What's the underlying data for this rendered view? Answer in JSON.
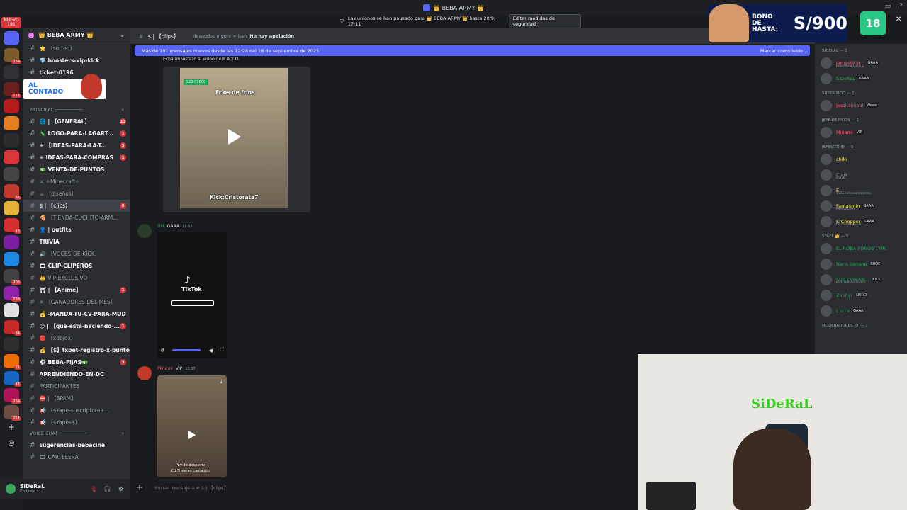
{
  "window": {
    "title": "👑 BEBA ARMY 👑"
  },
  "security": {
    "notice": "Las uniones se han pausado para 👑 BEBA ARMY 👑 hasta 20/9, 17:11",
    "button": "Editar medidas de seguridad"
  },
  "rail": {
    "nuevo_label": "NUEVO",
    "nuevo_count": "191",
    "badges": [
      "164",
      "117",
      "97",
      "43",
      "206",
      "738",
      "84",
      "21",
      "47",
      "164",
      "211"
    ]
  },
  "guild": {
    "name": "👑 BEBA ARMY 👑"
  },
  "channels": [
    {
      "name": "⭐ 〔sorteo〕",
      "type": "hash",
      "style": "dim"
    },
    {
      "name": "💎 boosters-vip-kick",
      "type": "hash",
      "style": "bright"
    },
    {
      "name": "ticket-0196",
      "type": "hash",
      "style": "bright"
    }
  ],
  "promo": {
    "line1": "AL",
    "line2": "CONTADO"
  },
  "category_principal": "PRINCIPAL ──────────",
  "channels2": [
    {
      "name": "🌐 | 【GENERAL】",
      "style": "bright",
      "badge": "13"
    },
    {
      "name": "🦎 LOGO-PARA-LAGART...",
      "style": "bright",
      "badge": "1"
    },
    {
      "name": "✳ 【IDEAS-PARA-LA-T...",
      "style": "bright",
      "badge": "3"
    },
    {
      "name": "✳ IDEAS-PARA-COMPRAS",
      "style": "bright",
      "badge": "1"
    },
    {
      "name": "💵 VENTA-DE-PUNTOS",
      "style": "bright",
      "badge": ""
    },
    {
      "name": "⚔ ✧Minecraft✧",
      "style": "dim",
      "badge": ""
    },
    {
      "name": "☕ 〔diseños〕",
      "style": "dim",
      "badge": ""
    },
    {
      "name": "$ | 【clips】",
      "style": "active",
      "badge": "8"
    },
    {
      "name": "🍕 〔TIENDA-CUCHITO-ARM...",
      "style": "dim",
      "badge": ""
    },
    {
      "name": "👤 | outfits",
      "style": "bright",
      "badge": ""
    },
    {
      "name": "TRIVIA",
      "style": "bright",
      "badge": ""
    },
    {
      "name": "🔊 〔VOCES-DE-KICK〕",
      "style": "dim",
      "badge": ""
    },
    {
      "name": "🎞 CLIP-CLIPEROS",
      "style": "bright",
      "badge": ""
    },
    {
      "name": "👑 VIP-EXCLUSIVO",
      "style": "dim",
      "badge": ""
    },
    {
      "name": "⛩ | 【Anime】",
      "style": "bright",
      "badge": "1"
    },
    {
      "name": "✳ 〔GANADORES-DEL-MES〕",
      "style": "dim",
      "badge": ""
    },
    {
      "name": "💰 -MANDA-TU-CV-PARA-MOD",
      "style": "bright",
      "badge": ""
    },
    {
      "name": "😊 | 【que-está-haciendo-...",
      "style": "bright",
      "badge": "1"
    },
    {
      "name": "🔴 〔xdbjdx〕",
      "style": "dim",
      "badge": ""
    },
    {
      "name": "💰 【$】txbet-registro-x-puntos...",
      "style": "bright",
      "badge": ""
    },
    {
      "name": "⚽ BEBA-FIJAS💵",
      "style": "bright",
      "badge": "3"
    },
    {
      "name": "APRENDIENDO-EN-DC",
      "style": "bright",
      "badge": ""
    },
    {
      "name": "PARTICIPANTES",
      "style": "dim",
      "badge": ""
    },
    {
      "name": "⛔ | 【SPAM】",
      "style": "dim",
      "badge": ""
    },
    {
      "name": "📢 〔$Yape-suscriptorea...",
      "style": "dim",
      "badge": ""
    },
    {
      "name": "📢 〔$Yapes$〕",
      "style": "dim",
      "badge": ""
    }
  ],
  "category_voice": "VOICE CHAT ──────────",
  "channels3": [
    {
      "name": "sugerencias-bebacine",
      "style": "bright"
    },
    {
      "name": "🎞 CARTELERA",
      "style": "dim"
    }
  ],
  "user": {
    "name": "SiDeRaL",
    "status": "En línea"
  },
  "header": {
    "channel": "$ | 【clips】",
    "topic_prefix": "desnudos o gore = ban.",
    "topic_bold": "No hay apelación"
  },
  "newbar": {
    "text": "Más de 101 mensajes nuevos desde las 12:28 del 18 de septiembre de 2025",
    "mark": "Marcar como leído"
  },
  "messages": {
    "caption": "Echa un vistazo al video de R A Y O.",
    "video1_title": "Fríos de fríos",
    "video1_score": "523 / 1000",
    "video1_credit": "Kick:Cristorata7",
    "msg2_author": "DM",
    "msg2_tag": "GAAA",
    "msg2_time": "11:37",
    "tiktok_label": "TikTok",
    "msg3_author": "Minami",
    "msg3_tag": "VIP",
    "msg3_time": "11:37",
    "video3_caption1": "Pov: te despierta",
    "video3_caption2": "Ed Sheeran cantando"
  },
  "composer": {
    "placeholder": "Enviar mensaje a # $ | 【clips】"
  },
  "members": {
    "sideral_cat": "SIDERAL — 2",
    "super_cat": "SUPER MOD — 1",
    "jefe_cat": "JEFE DE MODS — 1",
    "jefesito_cat": "JEFESITO 😎 — 5",
    "staff_cat": "STAFF 👑 — 5",
    "mods_cat": "MODERADORES 🛡 — 1",
    "list": [
      {
        "section": "sideral",
        "name": "JamesOCa...",
        "tag": "GAAA",
        "sub": "Jugando a Dota 2",
        "color": "#ff4d6d"
      },
      {
        "section": "sideral",
        "name": "SiDeRaL",
        "tag": "GAAA",
        "sub": "",
        "color": "#3ba55c"
      },
      {
        "section": "super",
        "name": "Jessi-senpai",
        "tag": "Weee",
        "sub": "",
        "color": "#ff4d6d"
      },
      {
        "section": "jefe",
        "name": "Minami",
        "tag": "VIP",
        "sub": "",
        "color": "#ff4d6d"
      },
      {
        "section": "jefesito",
        "name": "chiki",
        "tag": "",
        "sub": "",
        "color": "#f2e05a"
      },
      {
        "section": "jefesito",
        "name": "Clark.",
        "tag": "",
        "sub": "RSQK",
        "color": "#949ba4"
      },
      {
        "section": "jefesito",
        "name": "E...",
        "tag": "",
        "sub": "www.kick.com/elimao",
        "color": "#f2e05a"
      },
      {
        "section": "jefesito",
        "name": "Fantasmin",
        "tag": "GAAA",
        "sub": "Pienso bien.",
        "color": "#f2e05a"
      },
      {
        "section": "jefesito",
        "name": "SrChopper",
        "tag": "GAAA",
        "sub": "En canal de voz",
        "color": "#f2e05a"
      },
      {
        "section": "staff",
        "name": "EL ROBA FONOS TYRON...",
        "tag": "",
        "sub": "",
        "color": "#23a55a"
      },
      {
        "section": "staff",
        "name": "Nana banana",
        "tag": "RBOE",
        "sub": "",
        "color": "#23a55a"
      },
      {
        "section": "staff",
        "name": "SUB COMAN...",
        "tag": "KICK",
        "sub": "kick.com/redbullcs",
        "color": "#23a55a"
      },
      {
        "section": "staff",
        "name": "Zephyr",
        "tag": "NURO",
        "sub": "",
        "color": "#23a55a"
      },
      {
        "section": "staff",
        "name": "L u i s",
        "tag": "GAAA",
        "sub": "",
        "color": "#23a55a"
      }
    ]
  },
  "bono": {
    "line1": "BONO",
    "line2": "DE HASTA:",
    "amount": "S/900"
  },
  "age_badge": "18",
  "webcam": {
    "sign": "SiDeRaL"
  },
  "colors": {
    "accent": "#5865f2",
    "alert": "#da373c",
    "online": "#23a55a"
  }
}
